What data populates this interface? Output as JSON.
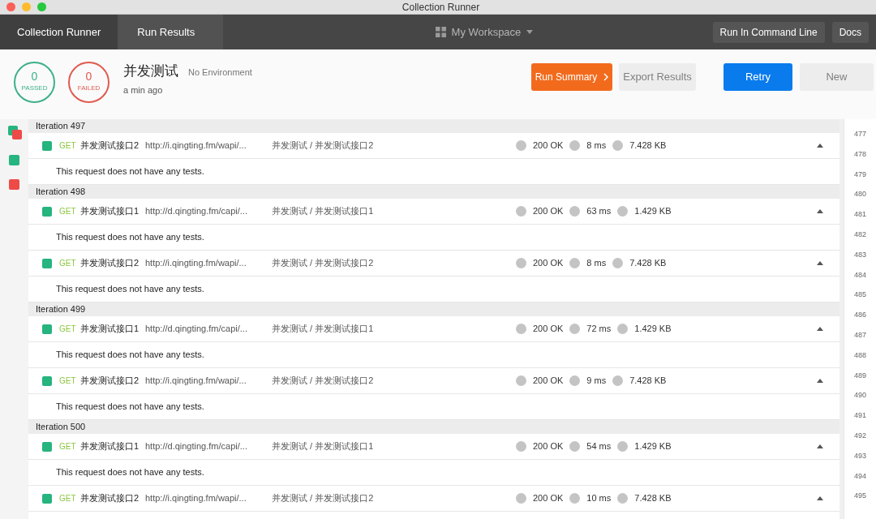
{
  "window": {
    "title": "Collection Runner"
  },
  "breadcrumbs": [
    {
      "label": "Collection Runner",
      "selected": false
    },
    {
      "label": "Run Results",
      "selected": true
    }
  ],
  "workspace": {
    "label": "My Workspace"
  },
  "nav_buttons": [
    "Run In Command Line",
    "Docs"
  ],
  "summary": {
    "passed": {
      "count": "0",
      "label": "PASSED"
    },
    "failed": {
      "count": "0",
      "label": "FAILED"
    },
    "title": "并发测试",
    "environment": "No Environment",
    "time": "a min ago"
  },
  "actions": [
    {
      "label": "Run Summary",
      "kind": "primary"
    },
    {
      "label": "Export Results",
      "kind": "plain"
    },
    {
      "label": "Retry",
      "kind": "accent"
    },
    {
      "label": "New",
      "kind": "plain"
    }
  ],
  "gutter_marks": [
    {
      "kind": "mixed"
    },
    {
      "kind": "pass"
    },
    {
      "kind": "fail"
    }
  ],
  "iterations": [
    {
      "label": "Iteration 497",
      "requests": [
        {
          "method": "GET",
          "name": "并发测试接口2",
          "url": "http://i.qingting.fm/wapi/...",
          "path": "并发测试 / 并发测试接口2",
          "status": "200 OK",
          "time": "8 ms",
          "size": "7.428 KB",
          "tests": "This request does not have any tests."
        }
      ]
    },
    {
      "label": "Iteration 498",
      "requests": [
        {
          "method": "GET",
          "name": "并发测试接口1",
          "url": "http://d.qingting.fm/capi/...",
          "path": "并发测试 / 并发测试接口1",
          "status": "200 OK",
          "time": "63 ms",
          "size": "1.429 KB",
          "tests": "This request does not have any tests."
        },
        {
          "method": "GET",
          "name": "并发测试接口2",
          "url": "http://i.qingting.fm/wapi/...",
          "path": "并发测试 / 并发测试接口2",
          "status": "200 OK",
          "time": "8 ms",
          "size": "7.428 KB",
          "tests": "This request does not have any tests."
        }
      ]
    },
    {
      "label": "Iteration 499",
      "requests": [
        {
          "method": "GET",
          "name": "并发测试接口1",
          "url": "http://d.qingting.fm/capi/...",
          "path": "并发测试 / 并发测试接口1",
          "status": "200 OK",
          "time": "72 ms",
          "size": "1.429 KB",
          "tests": "This request does not have any tests."
        },
        {
          "method": "GET",
          "name": "并发测试接口2",
          "url": "http://i.qingting.fm/wapi/...",
          "path": "并发测试 / 并发测试接口2",
          "status": "200 OK",
          "time": "9 ms",
          "size": "7.428 KB",
          "tests": "This request does not have any tests."
        }
      ]
    },
    {
      "label": "Iteration 500",
      "requests": [
        {
          "method": "GET",
          "name": "并发测试接口1",
          "url": "http://d.qingting.fm/capi/...",
          "path": "并发测试 / 并发测试接口1",
          "status": "200 OK",
          "time": "54 ms",
          "size": "1.429 KB",
          "tests": "This request does not have any tests."
        },
        {
          "method": "GET",
          "name": "并发测试接口2",
          "url": "http://i.qingting.fm/wapi/...",
          "path": "并发测试 / 并发测试接口2",
          "status": "200 OK",
          "time": "10 ms",
          "size": "7.428 KB"
        }
      ]
    }
  ],
  "line_numbers": [
    "477",
    "478",
    "479",
    "480",
    "481",
    "482",
    "483",
    "484",
    "485",
    "486",
    "487",
    "488",
    "489",
    "490",
    "491",
    "492",
    "493",
    "494",
    "495"
  ]
}
